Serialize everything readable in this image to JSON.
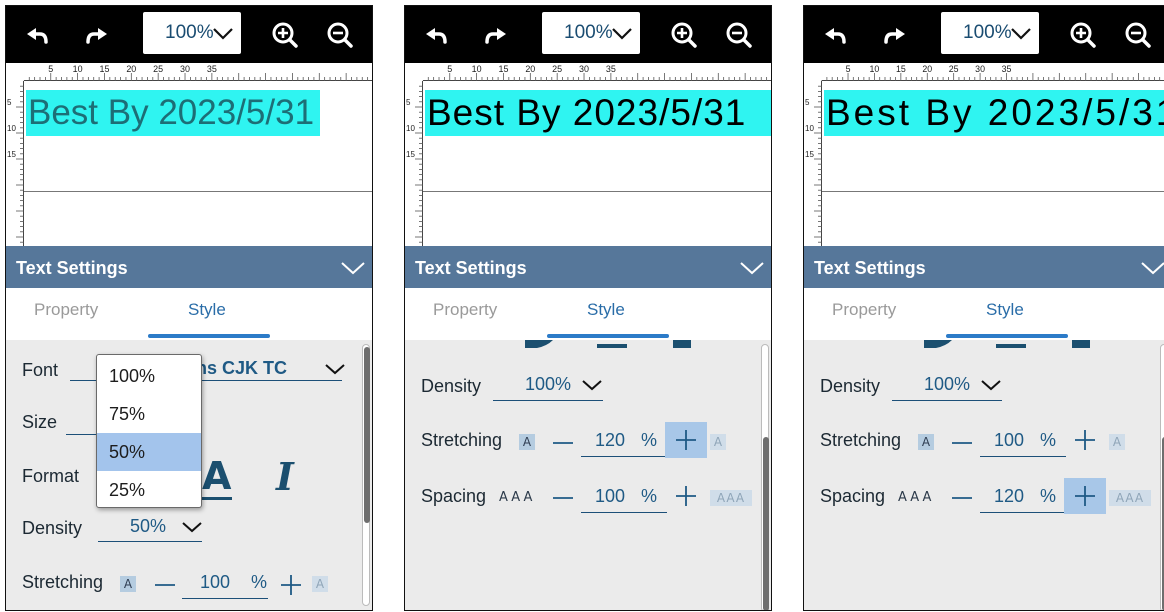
{
  "panels": [
    {
      "toolbar": {
        "zoom": "100%"
      },
      "canvas": {
        "label_text": "Best By 2023/5/31"
      },
      "text_settings": {
        "title": "Text Settings",
        "tabs": [
          "Property",
          "Style"
        ],
        "active_tab": "Style"
      },
      "style": {
        "font_label": "Font",
        "font_value": "Noto Sans CJK TC",
        "font_value_visible": "ns CJK TC",
        "size_label": "Size",
        "format_label": "Format",
        "format_bold": "A",
        "format_italic": "I",
        "density_label": "Density",
        "density_value": "50%",
        "stretching_label": "Stretching",
        "stretching_value": "100",
        "stretching_unit": "%",
        "mini_a": "A"
      },
      "dropdown": {
        "options": [
          "100%",
          "75%",
          "50%",
          "25%"
        ],
        "selected": "50%"
      }
    },
    {
      "toolbar": {
        "zoom": "100%"
      },
      "canvas": {
        "label_text": "Best By 2023/5/31"
      },
      "text_settings": {
        "title": "Text Settings",
        "tabs": [
          "Property",
          "Style"
        ],
        "active_tab": "Style"
      },
      "style": {
        "density_label": "Density",
        "density_value": "100%",
        "stretching_label": "Stretching",
        "stretching_value": "120",
        "stretching_unit": "%",
        "spacing_label": "Spacing",
        "spacing_value": "100",
        "spacing_unit": "%",
        "mini_a": "A",
        "aaa_small": "AAA",
        "aaa_box": "AAA"
      },
      "highlighted_button": "stretching-plus"
    },
    {
      "toolbar": {
        "zoom": "100%"
      },
      "canvas": {
        "label_text": "Best By 2023/5/31"
      },
      "text_settings": {
        "title": "Text Settings",
        "tabs": [
          "Property",
          "Style"
        ],
        "active_tab": "Style"
      },
      "style": {
        "density_label": "Density",
        "density_value": "100%",
        "stretching_label": "Stretching",
        "stretching_value": "100",
        "stretching_unit": "%",
        "spacing_label": "Spacing",
        "spacing_value": "120",
        "spacing_unit": "%",
        "mini_a": "A",
        "aaa_small": "AAA",
        "aaa_box": "AAA"
      },
      "highlighted_button": "spacing-plus"
    }
  ],
  "rulers": {
    "horizontal_ticks": [
      "5",
      "10",
      "15",
      "20",
      "25",
      "30",
      "35"
    ],
    "vertical_ticks": [
      "5",
      "10",
      "15"
    ]
  },
  "colors": {
    "toolbar_bg": "#000000",
    "header_bg": "#56779a",
    "highlight_text_bg": "#2ff4f1",
    "accent": "#2c7bc8",
    "selected_option_bg": "#a3c4ec",
    "pressed_button_bg": "#a8c7e8"
  },
  "icons": [
    "undo-icon",
    "redo-icon",
    "chevron-down-icon",
    "zoom-in-icon",
    "zoom-out-icon",
    "minus-icon",
    "plus-icon"
  ]
}
